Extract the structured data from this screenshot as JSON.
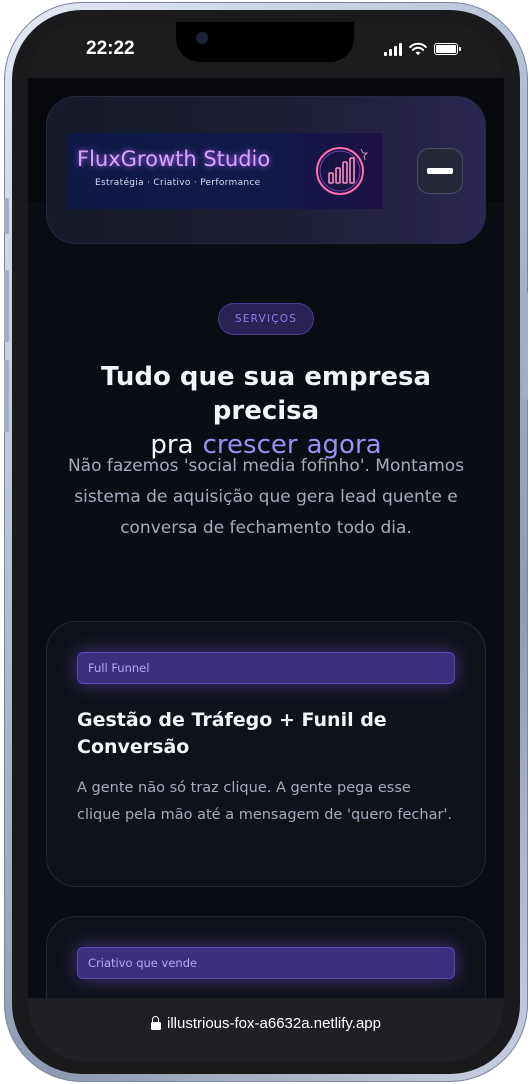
{
  "status_bar": {
    "time": "22:22",
    "icons": [
      "cellular-signal-icon",
      "wifi-icon",
      "battery-icon"
    ],
    "battery_level": 1.0
  },
  "header": {
    "brand_name": "FluxGrowth Studio",
    "brand_tagline": "Estratégia · Criativo · Performance",
    "menu_icon": "menu-icon"
  },
  "section": {
    "badge": "SERVIÇOS",
    "title_line1": "Tudo que sua empresa precisa",
    "title_line2_prefix": "pra",
    "title_line2_word1": "crescer",
    "title_line2_word2": "agora",
    "description": "Não fazemos 'social media fofinho'. Montamos sistema de aquisição que gera lead quente e conversa de fechamento todo dia."
  },
  "services": [
    {
      "tag": "Full Funnel",
      "title": "Gestão de Tráfego + Funil de Conversão",
      "description": "A gente não só traz clique. A gente pega esse clique pela mão até a mensagem de 'quero fechar'."
    },
    {
      "tag": "Criativo que vende"
    }
  ],
  "browser": {
    "url": "illustrious-fox-a6632a.netlify.app"
  },
  "colors": {
    "background": "#0b0d14",
    "accent": "#9d8ef3",
    "tag_bg": "#3c2f7f",
    "text_primary": "#f3f4f8",
    "text_muted": "#a6abbd"
  }
}
